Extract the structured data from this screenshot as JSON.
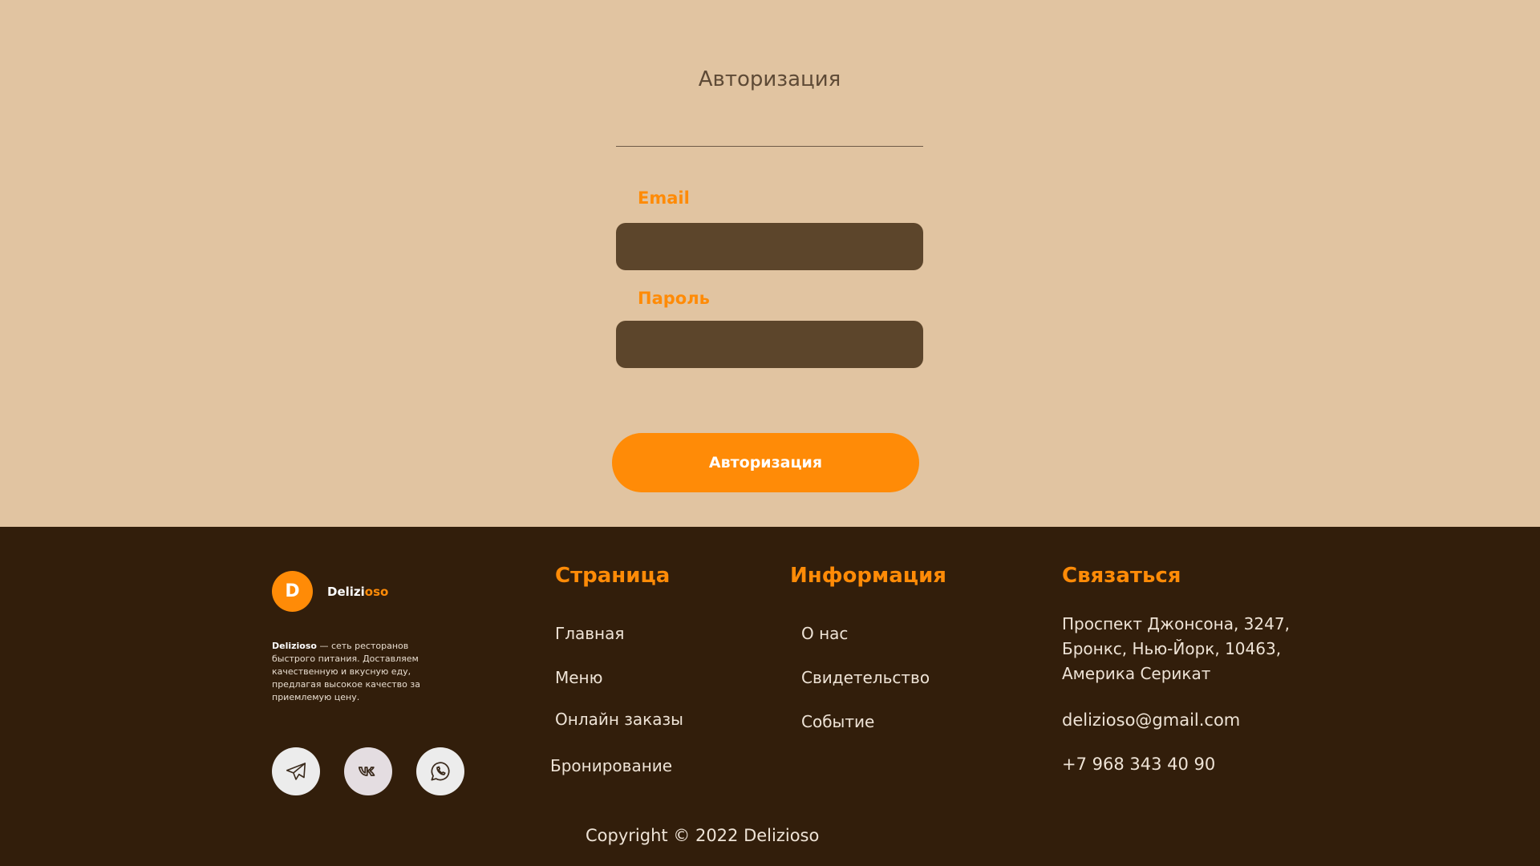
{
  "auth": {
    "title": "Авторизация",
    "email_label": "Email",
    "email_value": "",
    "password_label": "Пароль",
    "password_value": "",
    "submit_label": "Авторизация"
  },
  "footer": {
    "logo_letter": "D",
    "brand_part1": "Delizi",
    "brand_part2": "oso",
    "about_brand": "Delizioso",
    "about_text": " — сеть ресторанов быстрого питания. Доставляем качественную и вкусную еду, предлагая высокое качество за приемлемую цену.",
    "socials": [
      "telegram-icon",
      "vk-icon",
      "whatsapp-icon"
    ],
    "pages": {
      "title": "Страница",
      "items": [
        "Главная",
        "Меню",
        "Онлайн заказы",
        "Бронирование"
      ]
    },
    "info": {
      "title": "Информация",
      "items": [
        "О нас",
        "Свидетельство",
        "Событие"
      ]
    },
    "contact": {
      "title": "Связаться",
      "address_line1": "Проспект Джонсона, 3247,",
      "address_line2": "Бронкс, Нью-Йорк, 10463,",
      "address_line3": "Америка Серикат",
      "email": "delizioso@gmail.com",
      "phone": "+7 968 343 40 90"
    },
    "copyright": "Copyright © 2022 Delizioso"
  },
  "colors": {
    "background": "#e1c4a1",
    "accent": "#ff8b07",
    "input_bg": "#5c452b",
    "footer_bg": "#321e0b"
  }
}
